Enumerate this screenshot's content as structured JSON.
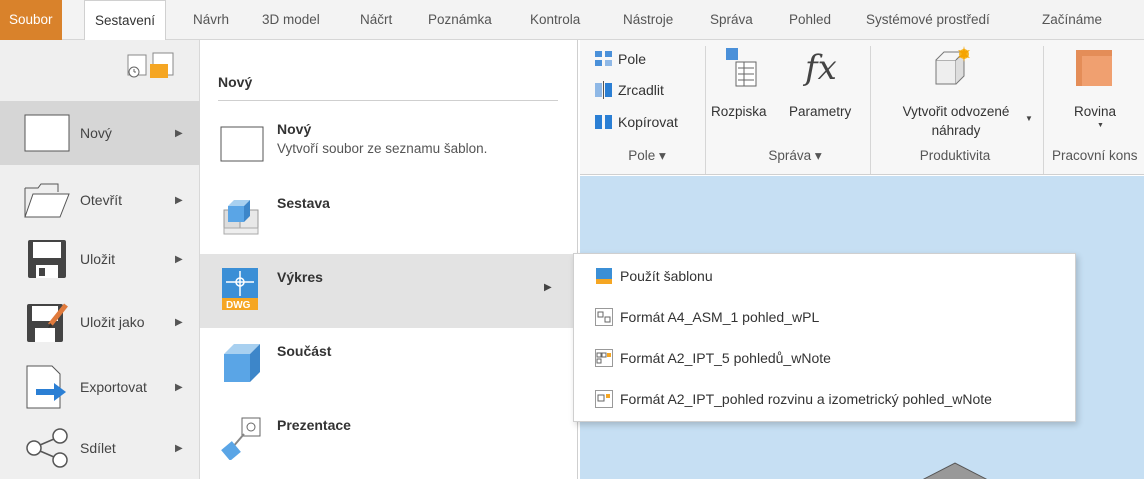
{
  "menu": {
    "tabs": [
      "Soubor",
      "Sestavení",
      "Návrh",
      "3D model",
      "Náčrt",
      "Poznámka",
      "Kontrola",
      "Nástroje",
      "Správa",
      "Pohled",
      "Systémové prostředí",
      "Začínáme"
    ]
  },
  "ribbon": {
    "pattern": {
      "pole": "Pole",
      "zrcadlit": "Zrcadlit",
      "kopirovat": "Kopírovat",
      "group": "Pole ▾"
    },
    "manage": {
      "rozpiska": "Rozpiska",
      "parametry": "Parametry",
      "group": "Správa ▾"
    },
    "productivity": {
      "line1": "Vytvořit odvozené",
      "line2": "náhrady",
      "group": "Produktivita"
    },
    "workfeatures": {
      "rovina": "Rovina",
      "group": "Pracovní kons"
    }
  },
  "sidebar": {
    "items": [
      {
        "label": "Nový"
      },
      {
        "label": "Otevřít"
      },
      {
        "label": "Uložit"
      },
      {
        "label": "Uložit jako"
      },
      {
        "label": "Exportovat"
      },
      {
        "label": "Sdílet"
      }
    ]
  },
  "panel": {
    "title": "Nový",
    "items": [
      {
        "name": "Nový",
        "desc": "Vytvoří soubor ze seznamu šablon."
      },
      {
        "name": "Sestava"
      },
      {
        "name": "Výkres"
      },
      {
        "name": "Součást"
      },
      {
        "name": "Prezentace"
      }
    ],
    "dwg_badge": "DWG"
  },
  "flyout": {
    "items": [
      {
        "label": "Použít šablonu"
      },
      {
        "label": "Formát A4_ASM_1 pohled_wPL"
      },
      {
        "label": "Formát A2_IPT_5 pohledů_wNote"
      },
      {
        "label": "Formát A2_IPT_pohled rozvinu a izometrický pohled_wNote"
      }
    ]
  },
  "colors": {
    "file_tab": "#d9822b",
    "canvas": "#c6dff3",
    "accent_blue": "#2b7fd4"
  }
}
